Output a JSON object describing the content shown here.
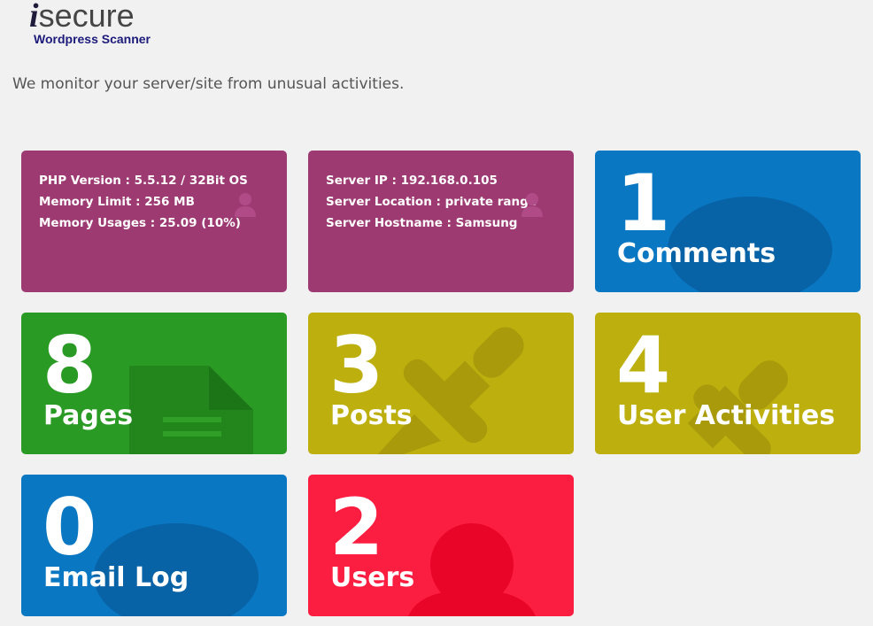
{
  "header": {
    "logo_main": "secure",
    "logo_i": "i",
    "logo_sub": "Wordpress Scanner",
    "tagline": "We monitor your server/site from unusual activities."
  },
  "php_info": {
    "line1": "PHP Version : 5.5.12 / 32Bit OS",
    "line2": "Memory Limit : 256 MB",
    "line3": "Memory Usages : 25.09 (10%)",
    "color": "#9d3a72"
  },
  "server_info": {
    "line1": "Server IP : 192.168.0.105",
    "line2": "Server Location : private range",
    "line3": "Server Hostname : Samsung",
    "color": "#9d3a72"
  },
  "tiles": {
    "comments": {
      "count": "1",
      "label": "Comments",
      "color": "#0a77c2",
      "icon": "comment-icon"
    },
    "pages": {
      "count": "8",
      "label": "Pages",
      "color": "#299a23",
      "icon": "page-icon"
    },
    "posts": {
      "count": "3",
      "label": "Posts",
      "color": "#bcaf0e",
      "icon": "pushpin-icon"
    },
    "user_activities": {
      "count": "4",
      "label": "User Activities",
      "color": "#bcaf0e",
      "icon": "pushpin-icon"
    },
    "email_log": {
      "count": "0",
      "label": "Email Log",
      "color": "#0a77c2",
      "icon": "comment-icon"
    },
    "users": {
      "count": "2",
      "label": "Users",
      "color": "#fc1e40",
      "icon": "user-icon"
    }
  }
}
